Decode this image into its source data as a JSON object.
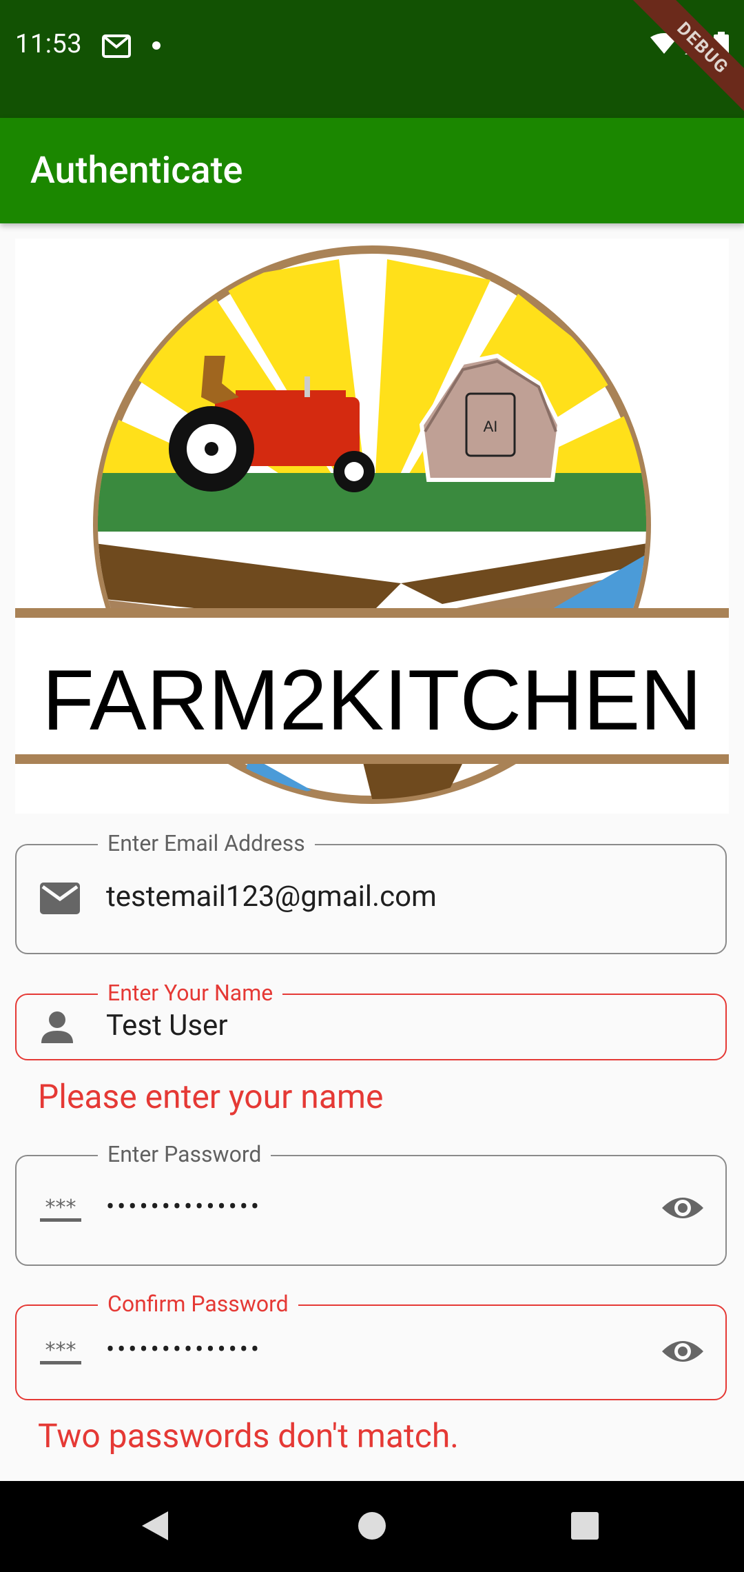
{
  "status_bar": {
    "time": "11:53",
    "debug_label": "DEBUG"
  },
  "app_bar": {
    "title": "Authenticate"
  },
  "logo": {
    "brand_text": "FARM2KITCHEN",
    "chip_text": "AI"
  },
  "form": {
    "email": {
      "label": "Enter Email Address",
      "value": "testemail123@gmail.com",
      "icon": "mail-icon"
    },
    "name": {
      "label": "Enter Your Name",
      "value": "Test User",
      "icon": "person-icon",
      "error": "Please enter your name"
    },
    "password": {
      "label": "Enter Password",
      "value": "••••••••••••••",
      "icon": "password-icon"
    },
    "confirm_password": {
      "label": "Confirm Password",
      "value": "••••••••••••••",
      "icon": "password-icon",
      "error": "Two passwords don't match."
    }
  },
  "colors": {
    "status_bar": "#125203",
    "app_bar": "#1b8700",
    "error": "#e53935"
  }
}
